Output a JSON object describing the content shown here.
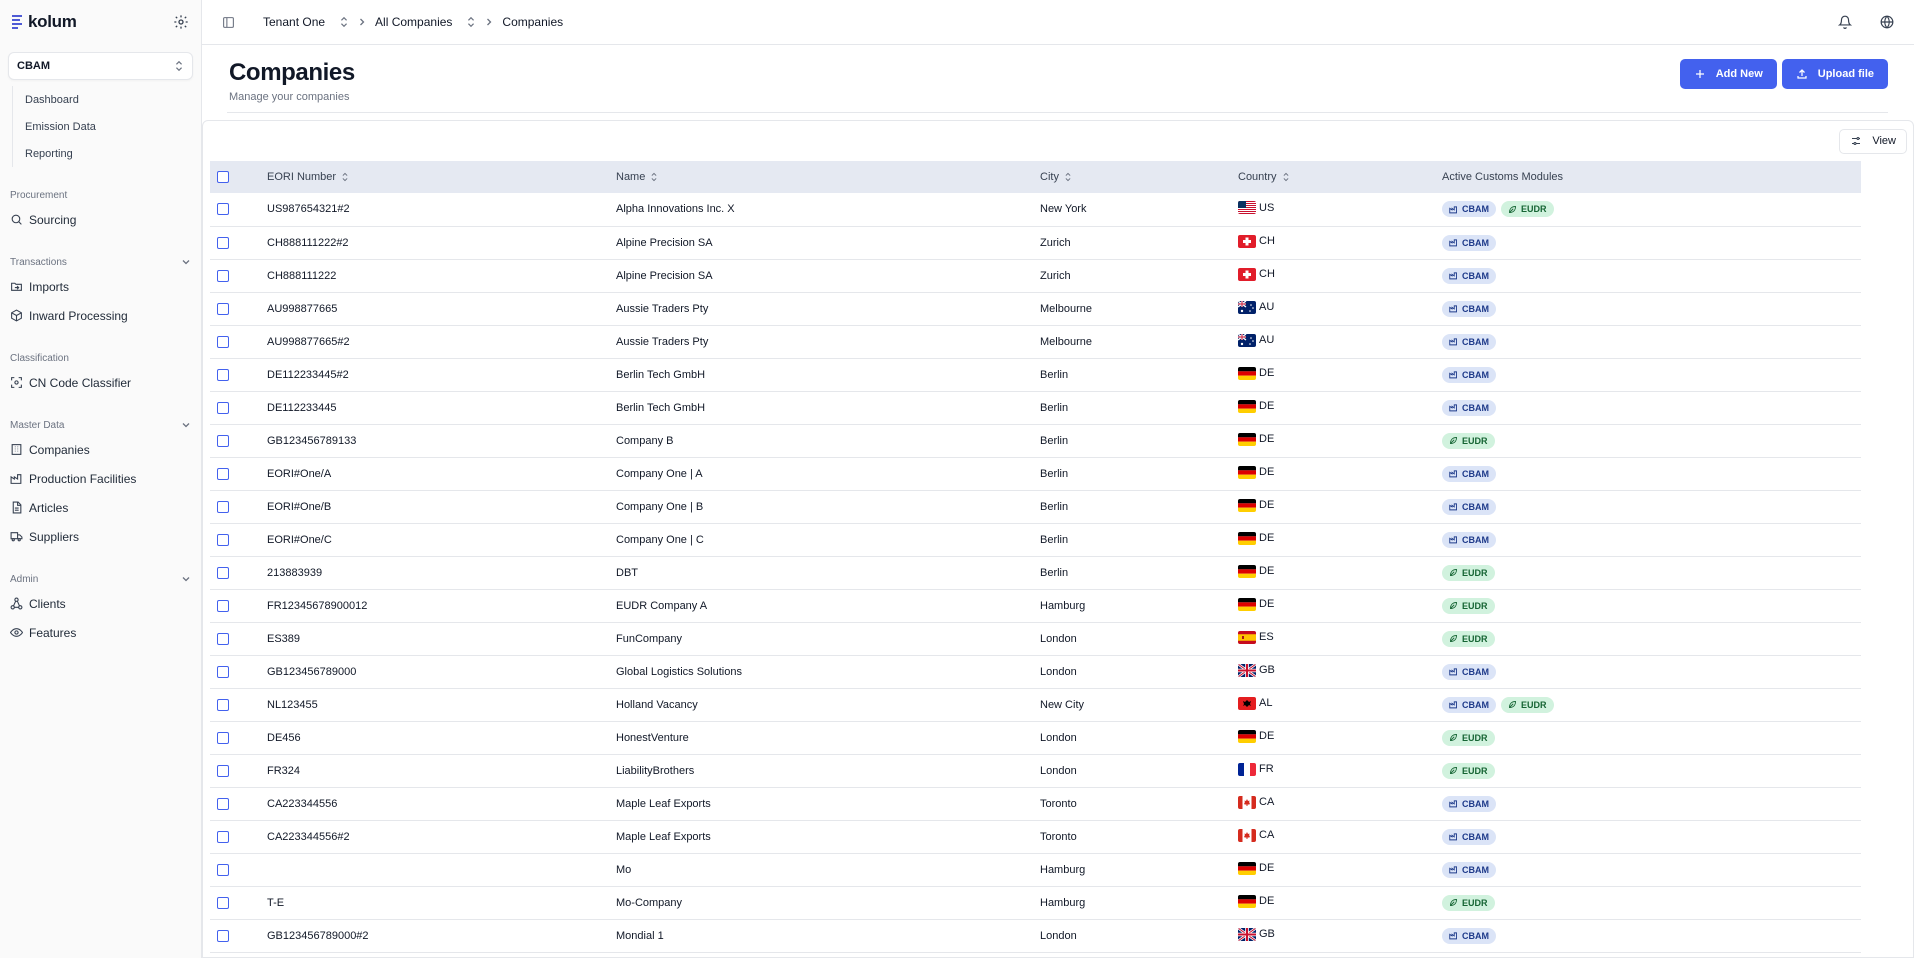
{
  "sidebar": {
    "brand": "kolum",
    "module": "CBAM",
    "module_items": [
      "Dashboard",
      "Emission Data",
      "Reporting"
    ],
    "groups": [
      {
        "title": "Procurement",
        "collapsible": false,
        "items": [
          {
            "label": "Sourcing",
            "icon": "search-icon"
          }
        ]
      },
      {
        "title": "Transactions",
        "collapsible": true,
        "items": [
          {
            "label": "Imports",
            "icon": "folder-import-icon"
          },
          {
            "label": "Inward Processing",
            "icon": "box-icon"
          }
        ]
      },
      {
        "title": "Classification",
        "collapsible": false,
        "items": [
          {
            "label": "CN Code Classifier",
            "icon": "scan-icon"
          }
        ]
      },
      {
        "title": "Master Data",
        "collapsible": true,
        "items": [
          {
            "label": "Companies",
            "icon": "building-icon"
          },
          {
            "label": "Production Facilities",
            "icon": "factory-icon"
          },
          {
            "label": "Articles",
            "icon": "file-icon"
          },
          {
            "label": "Suppliers",
            "icon": "truck-icon"
          }
        ]
      },
      {
        "title": "Admin",
        "collapsible": true,
        "items": [
          {
            "label": "Clients",
            "icon": "network-icon"
          },
          {
            "label": "Features",
            "icon": "eye-icon"
          }
        ]
      }
    ]
  },
  "topbar": {
    "crumbs": [
      "Tenant One",
      "All Companies",
      "Companies"
    ]
  },
  "header": {
    "title": "Companies",
    "subtitle": "Manage your companies",
    "add_label": "Add New",
    "upload_label": "Upload file"
  },
  "toolbar": {
    "view_label": "View"
  },
  "table": {
    "columns": [
      "EORI Number",
      "Name",
      "City",
      "Country",
      "Active Customs Modules"
    ],
    "rows": [
      {
        "eori": "US987654321#2",
        "name": "Alpha Innovations Inc. X",
        "city": "New York",
        "country": "US",
        "modules": [
          "CBAM",
          "EUDR"
        ]
      },
      {
        "eori": "CH888111222#2",
        "name": "Alpine Precision SA",
        "city": "Zurich",
        "country": "CH",
        "modules": [
          "CBAM"
        ]
      },
      {
        "eori": "CH888111222",
        "name": "Alpine Precision SA",
        "city": "Zurich",
        "country": "CH",
        "modules": [
          "CBAM"
        ]
      },
      {
        "eori": "AU998877665",
        "name": "Aussie Traders Pty",
        "city": "Melbourne",
        "country": "AU",
        "modules": [
          "CBAM"
        ]
      },
      {
        "eori": "AU998877665#2",
        "name": "Aussie Traders Pty",
        "city": "Melbourne",
        "country": "AU",
        "modules": [
          "CBAM"
        ]
      },
      {
        "eori": "DE112233445#2",
        "name": "Berlin Tech GmbH",
        "city": "Berlin",
        "country": "DE",
        "modules": [
          "CBAM"
        ]
      },
      {
        "eori": "DE112233445",
        "name": "Berlin Tech GmbH",
        "city": "Berlin",
        "country": "DE",
        "modules": [
          "CBAM"
        ]
      },
      {
        "eori": "GB123456789133",
        "name": "Company B",
        "city": "Berlin",
        "country": "DE",
        "modules": [
          "EUDR"
        ]
      },
      {
        "eori": "EORI#One/A",
        "name": "Company One | A",
        "city": "Berlin",
        "country": "DE",
        "modules": [
          "CBAM"
        ]
      },
      {
        "eori": "EORI#One/B",
        "name": "Company One | B",
        "city": "Berlin",
        "country": "DE",
        "modules": [
          "CBAM"
        ]
      },
      {
        "eori": "EORI#One/C",
        "name": "Company One | C",
        "city": "Berlin",
        "country": "DE",
        "modules": [
          "CBAM"
        ]
      },
      {
        "eori": "213883939",
        "name": "DBT",
        "city": "Berlin",
        "country": "DE",
        "modules": [
          "EUDR"
        ]
      },
      {
        "eori": "FR12345678900012",
        "name": "EUDR Company A",
        "city": "Hamburg",
        "country": "DE",
        "modules": [
          "EUDR"
        ]
      },
      {
        "eori": "ES389",
        "name": "FunCompany",
        "city": "London",
        "country": "ES",
        "modules": [
          "EUDR"
        ]
      },
      {
        "eori": "GB123456789000",
        "name": "Global Logistics Solutions",
        "city": "London",
        "country": "GB",
        "modules": [
          "CBAM"
        ]
      },
      {
        "eori": "NL123455",
        "name": "Holland Vacancy",
        "city": "New City",
        "country": "AL",
        "modules": [
          "CBAM",
          "EUDR"
        ]
      },
      {
        "eori": "DE456",
        "name": "HonestVenture",
        "city": "London",
        "country": "DE",
        "modules": [
          "EUDR"
        ]
      },
      {
        "eori": "FR324",
        "name": "LiabilityBrothers",
        "city": "London",
        "country": "FR",
        "modules": [
          "EUDR"
        ]
      },
      {
        "eori": "CA223344556",
        "name": "Maple Leaf Exports",
        "city": "Toronto",
        "country": "CA",
        "modules": [
          "CBAM"
        ]
      },
      {
        "eori": "CA223344556#2",
        "name": "Maple Leaf Exports",
        "city": "Toronto",
        "country": "CA",
        "modules": [
          "CBAM"
        ]
      },
      {
        "eori": "",
        "name": "Mo",
        "city": "Hamburg",
        "country": "DE",
        "modules": [
          "CBAM"
        ]
      },
      {
        "eori": "T-E",
        "name": "Mo-Company",
        "city": "Hamburg",
        "country": "DE",
        "modules": [
          "EUDR"
        ]
      },
      {
        "eori": "GB123456789000#2",
        "name": "Mondial 1",
        "city": "London",
        "country": "GB",
        "modules": [
          "CBAM"
        ]
      }
    ]
  },
  "colors": {
    "accent": "#4361ee",
    "cbam_bg": "#dbe4f7",
    "cbam_fg": "#1e3a8a",
    "eudr_bg": "#d1f2de",
    "eudr_fg": "#166534"
  }
}
